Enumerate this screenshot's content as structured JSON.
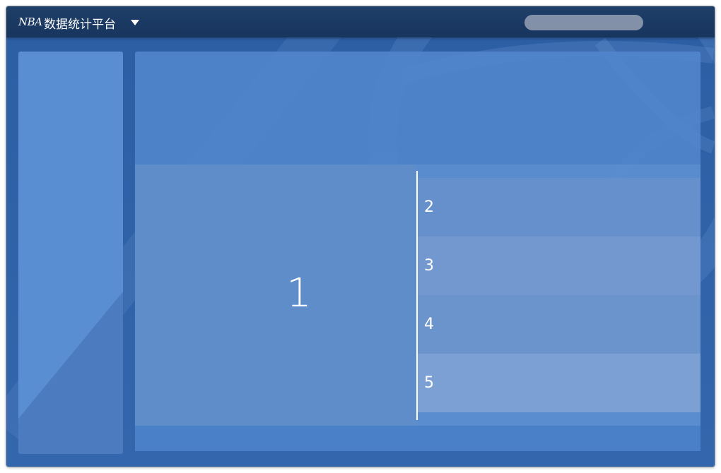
{
  "app": {
    "logo_text": "NBA",
    "title": "数据统计平台"
  },
  "featured": {
    "number": "1"
  },
  "ranks": [
    {
      "number": "2"
    },
    {
      "number": "3"
    },
    {
      "number": "4"
    },
    {
      "number": "5"
    }
  ],
  "colors": {
    "titlebar": "#17355e",
    "window_bg": "#2c5ea4",
    "panel": "#5085cc",
    "sidebar": "#5a8ed2",
    "featured": "#5e8dca",
    "row_light": "#7a9fd2",
    "row_mid": "#6a94ce",
    "text": "#ffffff"
  },
  "icons": {
    "dropdown": "caret-down-icon",
    "logo": "nba-logo-icon"
  }
}
